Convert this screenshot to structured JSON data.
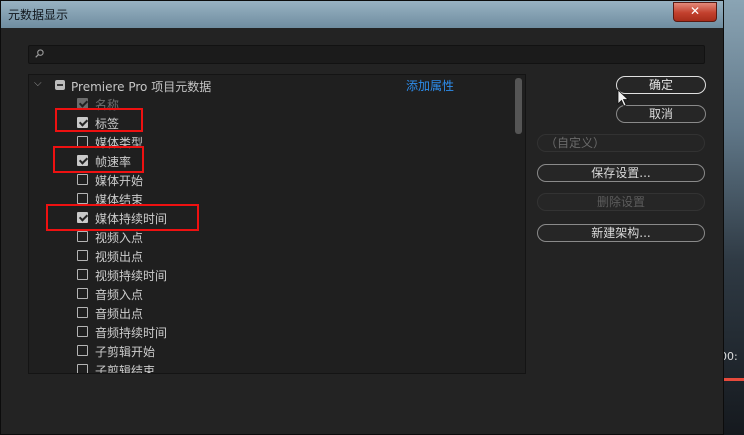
{
  "dialog": {
    "title": "元数据显示",
    "close_label": "✕",
    "search_placeholder": ""
  },
  "tree": {
    "section_title": "Premiere Pro 项目元数据",
    "add_property_label": "添加属性",
    "items": [
      {
        "label": "名称",
        "checked": true,
        "disabled": true
      },
      {
        "label": "标签",
        "checked": true,
        "disabled": false
      },
      {
        "label": "媒体类型",
        "checked": false,
        "disabled": false
      },
      {
        "label": "帧速率",
        "checked": true,
        "disabled": false
      },
      {
        "label": "媒体开始",
        "checked": false,
        "disabled": false
      },
      {
        "label": "媒体结束",
        "checked": false,
        "disabled": false
      },
      {
        "label": "媒体持续时间",
        "checked": true,
        "disabled": false
      },
      {
        "label": "视频入点",
        "checked": false,
        "disabled": false
      },
      {
        "label": "视频出点",
        "checked": false,
        "disabled": false
      },
      {
        "label": "视频持续时间",
        "checked": false,
        "disabled": false
      },
      {
        "label": "音频入点",
        "checked": false,
        "disabled": false
      },
      {
        "label": "音频出点",
        "checked": false,
        "disabled": false
      },
      {
        "label": "音频持续时间",
        "checked": false,
        "disabled": false
      },
      {
        "label": "子剪辑开始",
        "checked": false,
        "disabled": false
      },
      {
        "label": "子剪辑结束",
        "checked": false,
        "disabled": false
      }
    ]
  },
  "actions": {
    "ok_label": "确定",
    "cancel_label": "取消",
    "preset_value": "（自定义）",
    "save_settings_label": "保存设置...",
    "delete_settings_label": "删除设置",
    "new_schema_label": "新建架构..."
  },
  "background": {
    "timecode_fragment": "00:"
  },
  "colors": {
    "highlight_box": "#ee1111",
    "link": "#2d8ceb",
    "close_button": "#c2402d"
  }
}
